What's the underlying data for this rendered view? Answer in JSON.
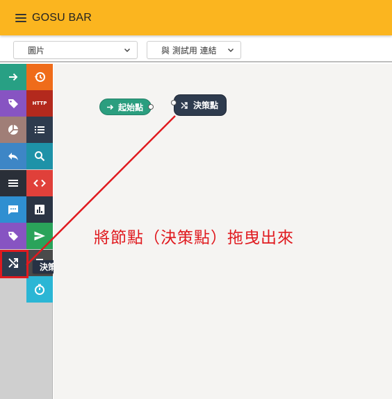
{
  "header": {
    "title": "GOSU BAR"
  },
  "toolbar": {
    "node_type_select": "圖片",
    "connection_select": "與 測試用 連結"
  },
  "palette": {
    "tiles": [
      {
        "name": "arrow-right-icon",
        "color": "#28a084"
      },
      {
        "name": "history-icon",
        "color": "#ef6c1a"
      },
      {
        "name": "tag-icon",
        "color": "#8754c2"
      },
      {
        "name": "http-icon",
        "label": "HTTP",
        "color": "#b3291d"
      },
      {
        "name": "pie-chart-icon",
        "color": "#a07e77"
      },
      {
        "name": "list-icon",
        "color": "#2e3b4e"
      },
      {
        "name": "reply-icon",
        "color": "#3d86c6"
      },
      {
        "name": "search-icon",
        "color": "#1e92a8"
      },
      {
        "name": "menu-icon",
        "color": "#2a2f38"
      },
      {
        "name": "code-icon",
        "color": "#e0403a"
      },
      {
        "name": "chat-icon",
        "color": "#2f8fd1"
      },
      {
        "name": "bar-chart-icon",
        "color": "#2a3444"
      },
      {
        "name": "tag-icon",
        "color": "#8754c2"
      },
      {
        "name": "send-icon",
        "color": "#2aa35a"
      },
      {
        "name": "shuffle-icon",
        "color": "#2e3b4e"
      },
      {
        "name": "document-icon",
        "color": "#4a4a4a"
      },
      {
        "name": "timer-icon",
        "color": "#2bb6d5"
      }
    ],
    "tooltip": "決策點"
  },
  "canvas": {
    "start_node": {
      "label": "起始點",
      "color": "#2b9e7f"
    },
    "decision_node": {
      "label": "決策點",
      "color": "#2e3b4e"
    },
    "annotation": {
      "text": "將節點（決策點）拖曳出來",
      "color": "#e01a1f"
    }
  }
}
